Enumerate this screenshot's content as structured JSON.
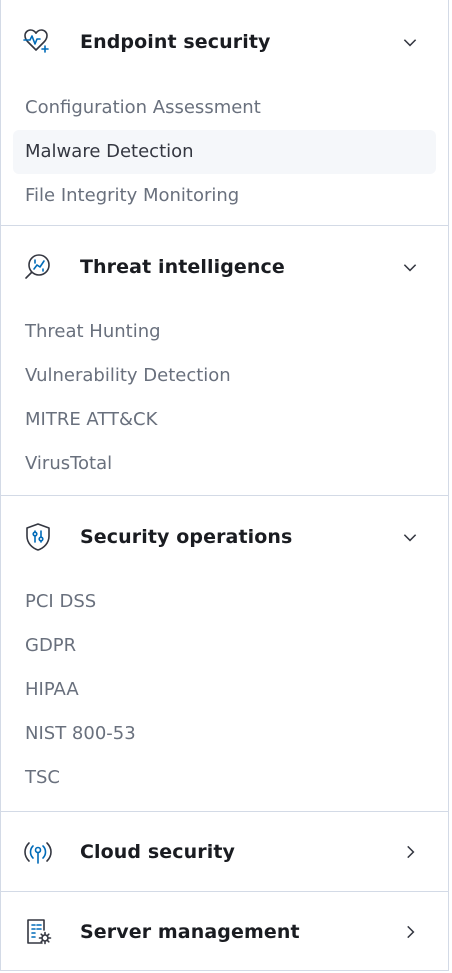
{
  "nav": {
    "sections": [
      {
        "title": "Endpoint security",
        "icon": "heartbeat-monitor-icon",
        "expanded": true,
        "items": [
          "Configuration Assessment",
          "Malware Detection",
          "File Integrity Monitoring"
        ],
        "active_item": "Malware Detection"
      },
      {
        "title": "Threat intelligence",
        "icon": "threat-search-icon",
        "expanded": true,
        "items": [
          "Threat Hunting",
          "Vulnerability Detection",
          "MITRE ATT&CK",
          "VirusTotal"
        ]
      },
      {
        "title": "Security operations",
        "icon": "shield-settings-icon",
        "expanded": true,
        "items": [
          "PCI DSS",
          "GDPR",
          "HIPAA",
          "NIST 800-53",
          "TSC"
        ]
      },
      {
        "title": "Cloud security",
        "icon": "cloud-antenna-icon",
        "expanded": false,
        "items": []
      },
      {
        "title": "Server management",
        "icon": "server-doc-gear-icon",
        "expanded": false,
        "items": []
      }
    ]
  },
  "colors": {
    "accent": "#006bb8",
    "border": "#d3dae6",
    "active_bg": "#f5f7fa",
    "item_text": "#69707d",
    "title_text": "#1a1c21"
  }
}
